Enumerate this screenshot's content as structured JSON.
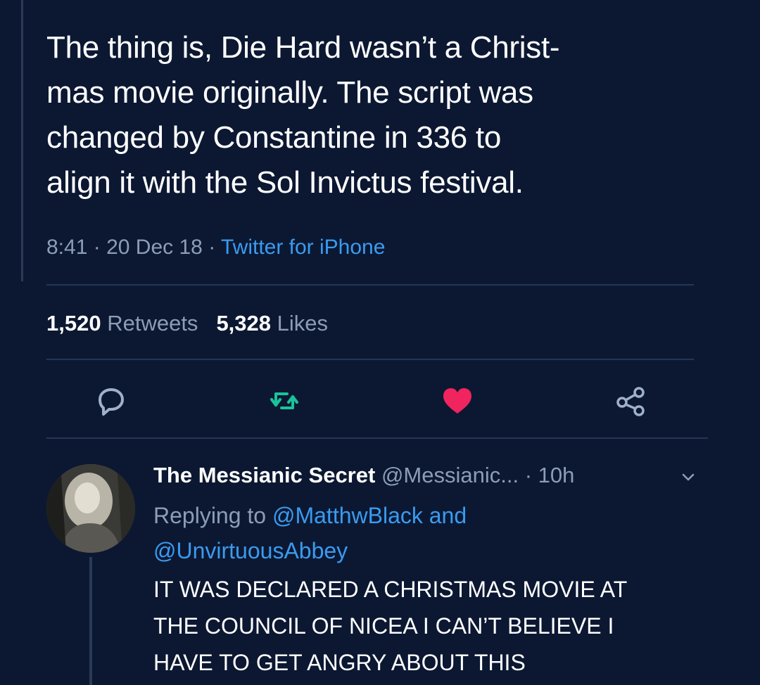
{
  "tweet": {
    "text_lines": [
      "The thing is, Die Hard wasn’t a Christ-",
      "mas movie originally. The script was",
      "changed by Constantine in 336 to",
      "align it with the Sol Invictus festival."
    ],
    "time": "8:41",
    "date": "20 Dec 18",
    "separator": "·",
    "source": "Twitter for iPhone",
    "retweet_count": "1,520",
    "retweet_label": "Retweets",
    "like_count": "5,328",
    "like_label": "Likes"
  },
  "actions": {
    "reply_icon": "reply-icon",
    "retweet_icon": "retweet-icon",
    "like_icon": "heart-icon",
    "share_icon": "share-icon",
    "retweet_color": "#19c39a",
    "like_color": "#f0245f"
  },
  "reply": {
    "display_name": "The Messianic Secret",
    "handle": "@Messianic...",
    "separator": "·",
    "age": "10h",
    "replying_prefix": "Replying to",
    "mention_1": "@MatthwBlack",
    "conjunction": "and",
    "mention_2": "@UnvirtuousAbbey",
    "body_lines": [
      "IT WAS DECLARED A CHRISTMAS MOVIE AT",
      "THE COUNCIL OF NICEA I CAN’T BELIEVE I",
      "HAVE TO GET ANGRY ABOUT THIS"
    ]
  },
  "colors": {
    "background": "#0c1832",
    "link": "#3a9bf0",
    "muted_text": "#8d9db5"
  }
}
